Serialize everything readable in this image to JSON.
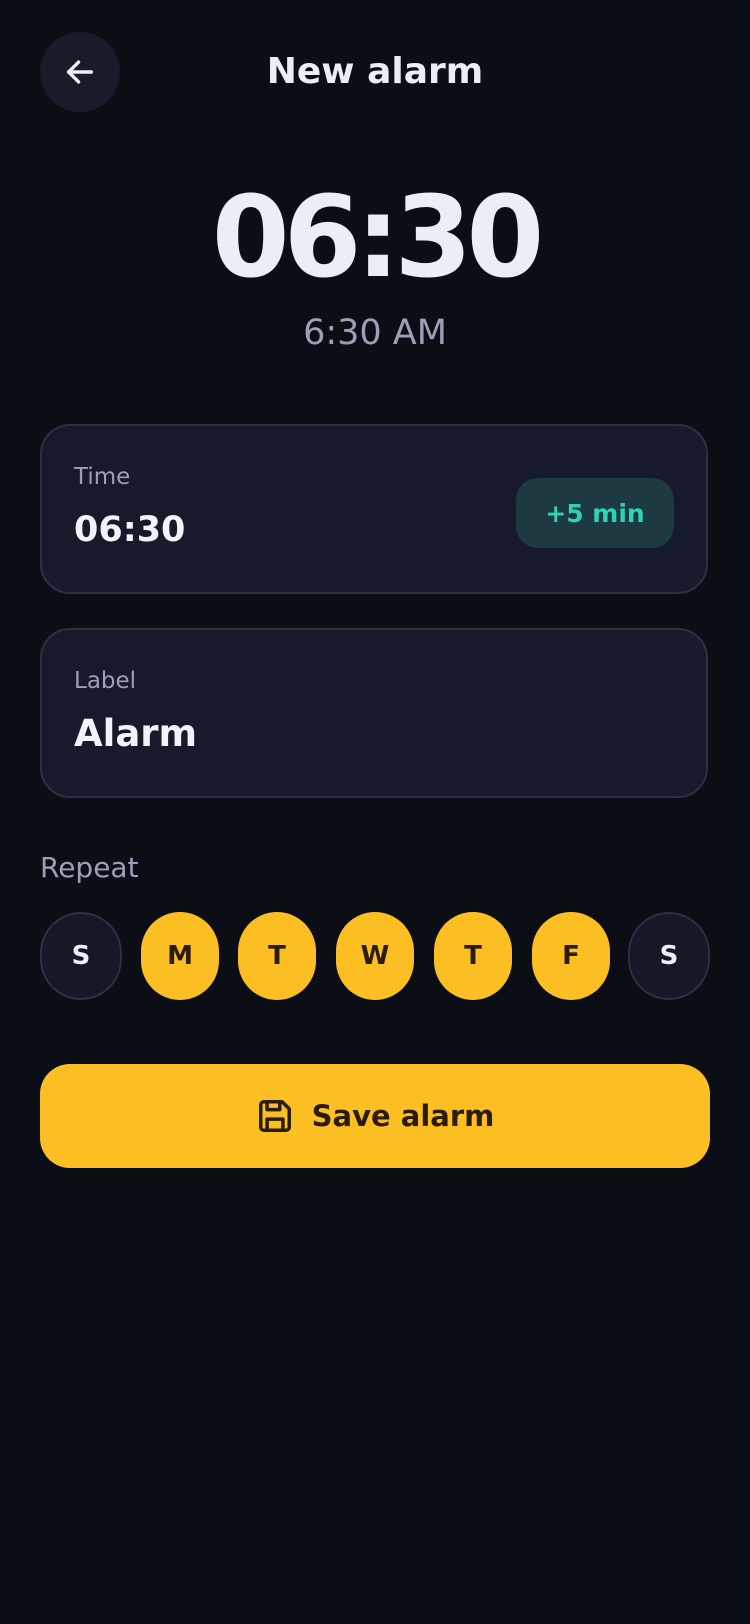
{
  "header": {
    "title": "New alarm",
    "back_icon": "arrow-left-icon"
  },
  "clock": {
    "display": "06:30",
    "meridiem_display": "6:30 AM"
  },
  "time_card": {
    "caption": "Time",
    "value": "06:30",
    "snooze_button_label": "+5 min"
  },
  "label_card": {
    "caption": "Label",
    "value": "Alarm"
  },
  "repeat": {
    "heading": "Repeat",
    "days": [
      {
        "letter": "S",
        "selected": false
      },
      {
        "letter": "M",
        "selected": true
      },
      {
        "letter": "T",
        "selected": true
      },
      {
        "letter": "W",
        "selected": true
      },
      {
        "letter": "T",
        "selected": true
      },
      {
        "letter": "F",
        "selected": true
      },
      {
        "letter": "S",
        "selected": false
      }
    ]
  },
  "save": {
    "label": "Save alarm",
    "icon": "floppy-disk-icon"
  },
  "colors": {
    "background": "#0c0e16",
    "card": "#171a2a",
    "accent": "#fbbf24",
    "snooze_bg": "#1c3a3f",
    "snooze_text": "#2dd4b4",
    "muted_text": "#9ba0b8",
    "primary_text": "#eceef5"
  }
}
